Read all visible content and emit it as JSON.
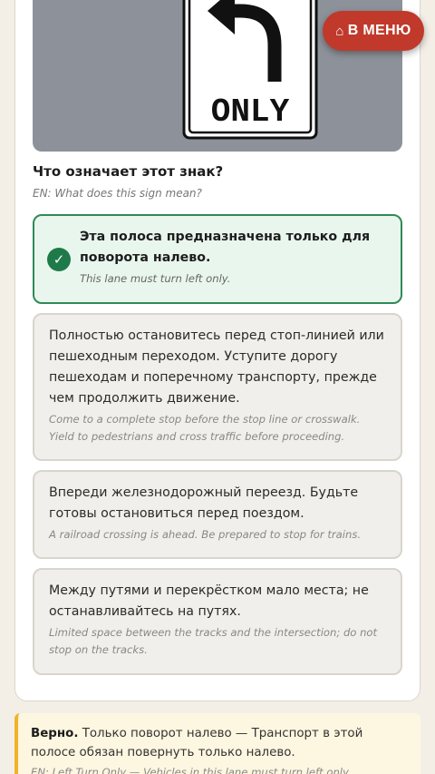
{
  "menu_button": {
    "icon": "home-icon",
    "label": "В МЕНЮ"
  },
  "sign": {
    "text": "ONLY"
  },
  "question": {
    "text": "Что означает этот знак?",
    "en": "EN: What does this sign mean?"
  },
  "options": [
    {
      "ru": "Эта полоса предназначена только для поворота налево.",
      "en": "This lane must turn left only.",
      "correct": true
    },
    {
      "ru": "Полностью остановитесь перед стоп-линией или пешеходным переходом. Уступите дорогу пешеходам и поперечному транспорту, прежде чем продолжить движение.",
      "en": "Come to a complete stop before the stop line or crosswalk. Yield to pedestrians and cross traffic before proceeding.",
      "correct": false
    },
    {
      "ru": "Впереди железнодорожный переезд. Будьте готовы остановиться перед поездом.",
      "en": "A railroad crossing is ahead. Be prepared to stop for trains.",
      "correct": false
    },
    {
      "ru": "Между путями и перекрёстком мало места; не останавливайтесь на путях.",
      "en": "Limited space between the tracks and the intersection; do not stop on the tracks.",
      "correct": false
    }
  ],
  "check_icon": "✓",
  "feedback": {
    "strong": "Верно.",
    "text": "Только поворот налево — Транспорт в этой полосе обязан повернуть только налево.",
    "en": "EN: Left Turn Only — Vehicles in this lane must turn left only."
  },
  "colors": {
    "accent_red": "#c0392b",
    "correct_green": "#2e8b57",
    "feedback_yellow": "#f0b429"
  }
}
